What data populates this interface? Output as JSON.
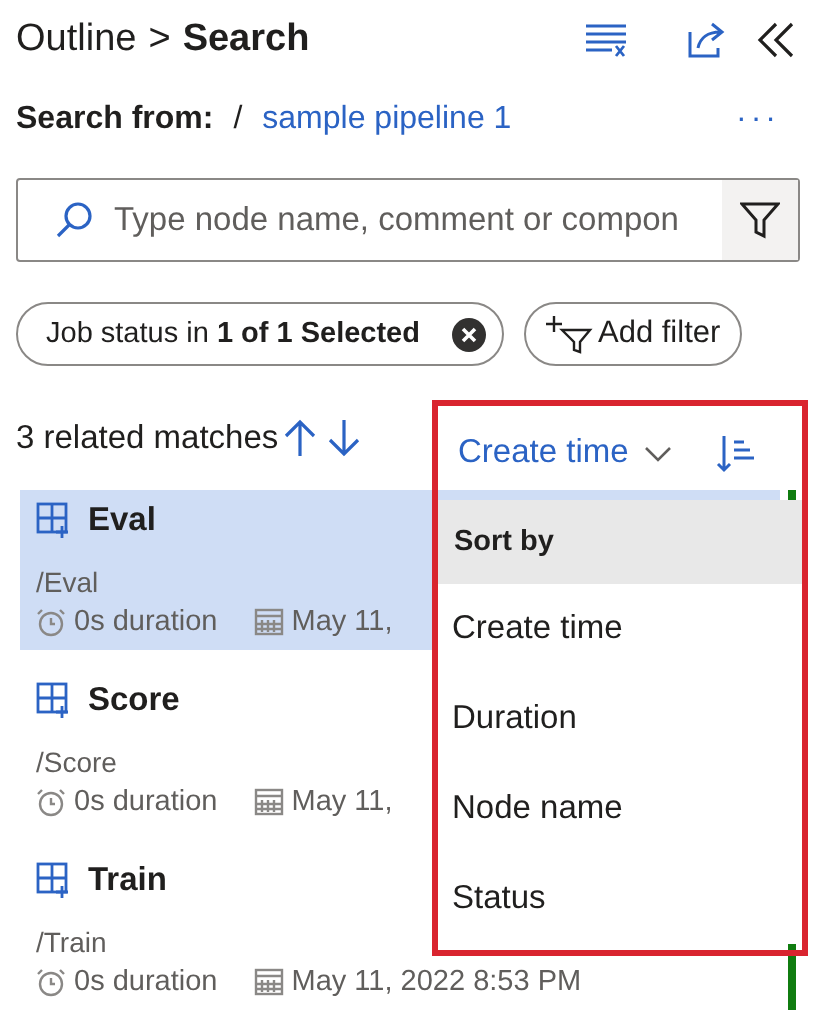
{
  "breadcrumb": {
    "parent": "Outline",
    "separator": ">",
    "current": "Search"
  },
  "search_from": {
    "label": "Search from:",
    "separator": "/",
    "link": "sample pipeline 1",
    "more": "···"
  },
  "search": {
    "placeholder": "Type node name, comment or compon"
  },
  "filters": [
    {
      "kind": "chip",
      "text": "Job status in **1 of 1 Selected**"
    },
    {
      "kind": "add",
      "text": "Add filter"
    }
  ],
  "matches": {
    "count": "3 related matches"
  },
  "sort": {
    "value": "Create time"
  },
  "results": [
    {
      "name": "Eval",
      "path": "/Eval",
      "duration": "0s duration",
      "date": "May 11,",
      "selected": true,
      "color": "#107c10"
    },
    {
      "name": "Score",
      "path": "/Score",
      "duration": "0s duration",
      "date": "May 11,",
      "selected": false
    },
    {
      "name": "Train",
      "path": "/Train",
      "duration": "0s duration",
      "date": "May 11, 2022 8:53 PM",
      "selected": false,
      "color": "#107c10"
    }
  ],
  "sort_menu": {
    "header": "Sort by",
    "options": [
      "Create time",
      "Duration",
      "Node name",
      "Status"
    ]
  }
}
